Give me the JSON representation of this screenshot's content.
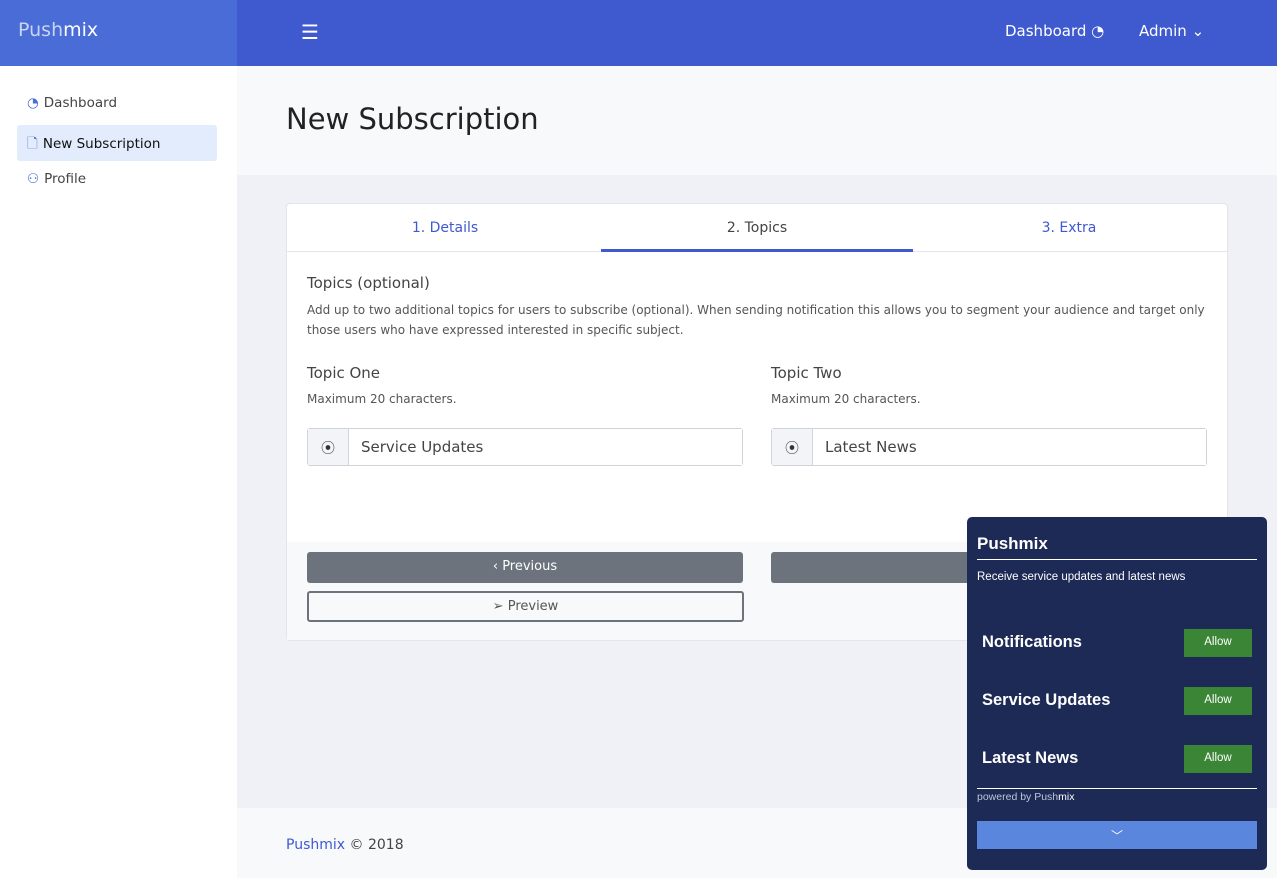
{
  "brand": {
    "part1": "Push",
    "part2": "mix"
  },
  "topbar": {
    "menu_icon": "☰",
    "dashboard": "Dashboard",
    "dashboard_icon": "◔",
    "admin": "Admin",
    "admin_icon": "⌄"
  },
  "sidebar": {
    "items": [
      {
        "label": "Dashboard",
        "icon": "◔"
      },
      {
        "label": "New Subscription",
        "icon": "🗋"
      },
      {
        "label": "Profile",
        "icon": "⚇"
      }
    ]
  },
  "page_title": "New Subscription",
  "tabs": [
    "1. Details",
    "2. Topics",
    "3. Extra"
  ],
  "topics": {
    "heading": "Topics (optional)",
    "description": "Add up to two additional topics for users to subscribe (optional). When sending notification this allows you to segment your audience and target only those users who have expressed interested in specific subject.",
    "one": {
      "label": "Topic One",
      "hint": "Maximum 20 characters.",
      "value": "Service Updates"
    },
    "two": {
      "label": "Topic Two",
      "hint": "Maximum 20 characters.",
      "value": "Latest News"
    }
  },
  "buttons": {
    "previous": "Previous",
    "preview": "Preview"
  },
  "footer": {
    "brand": "Pushmix",
    "copy": "© 2018"
  },
  "widget": {
    "title": "Pushmix",
    "description": "Receive service updates and latest news",
    "rows": [
      {
        "label": "Notifications",
        "button": "Allow"
      },
      {
        "label": "Service Updates",
        "button": "Allow"
      },
      {
        "label": "Latest News",
        "button": "Allow"
      }
    ],
    "powered_by": "powered by Push",
    "powered_brand": "mix"
  }
}
